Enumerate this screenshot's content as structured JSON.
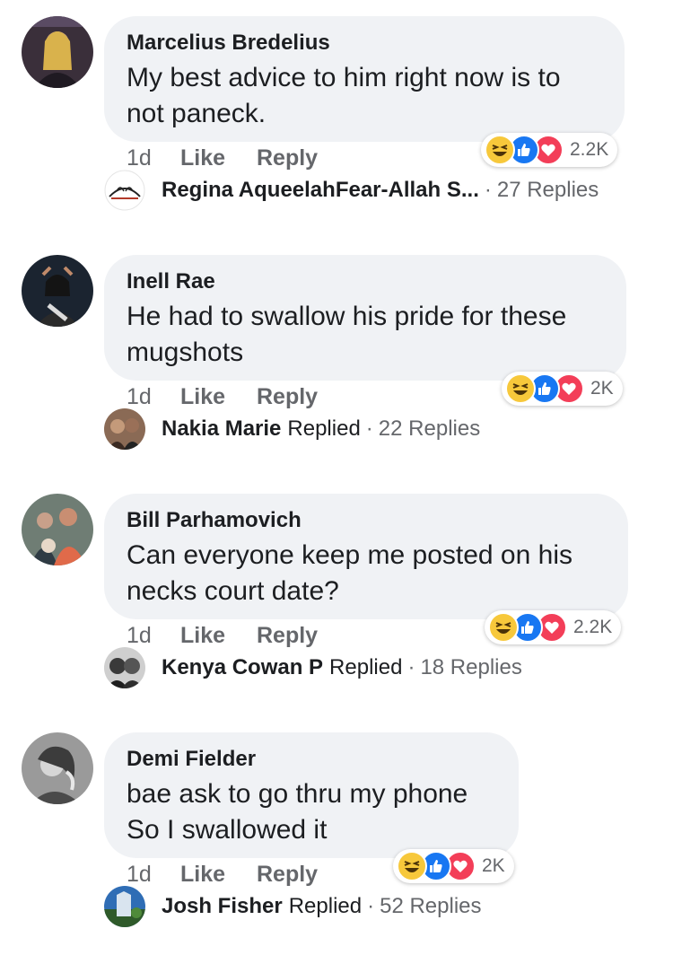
{
  "actions": {
    "time": "1d",
    "like": "Like",
    "reply": "Reply"
  },
  "comments": [
    {
      "author": "Marcelius Bredelius",
      "line1": "My best advice to him right now is to",
      "line2": "not paneck.",
      "reaction_count": "2.2K",
      "reply_author": "Regina AqueelahFear-Allah S...",
      "reply_verb": "",
      "reply_count": "27 Replies"
    },
    {
      "author": "Inell Rae",
      "line1": "He had to swallow his pride for these",
      "line2": "mugshots",
      "reaction_count": "2K",
      "reply_author": "Nakia Marie",
      "reply_verb": "Replied",
      "reply_count": "22 Replies"
    },
    {
      "author": "Bill Parhamovich",
      "line1": "Can everyone keep me posted on his",
      "line2": "necks court date?",
      "reaction_count": "2.2K",
      "reply_author": "Kenya Cowan P",
      "reply_verb": "Replied",
      "reply_count": "18 Replies"
    },
    {
      "author": "Demi Fielder",
      "line1": "bae ask to go thru my phone",
      "line2": "So I swallowed it",
      "reaction_count": "2K",
      "reply_author": "Josh Fisher",
      "reply_verb": "Replied",
      "reply_count": "52 Replies"
    }
  ],
  "icons": {
    "avatar": "avatar",
    "reactions": [
      "haha-reaction-icon",
      "like-reaction-icon",
      "love-reaction-icon"
    ]
  },
  "colors": {
    "bubble": "#f0f2f5",
    "meta_text": "#65676b",
    "like_blue": "#1877f2",
    "love_red": "#f33e58",
    "haha_yellow": "#f7c83b"
  }
}
